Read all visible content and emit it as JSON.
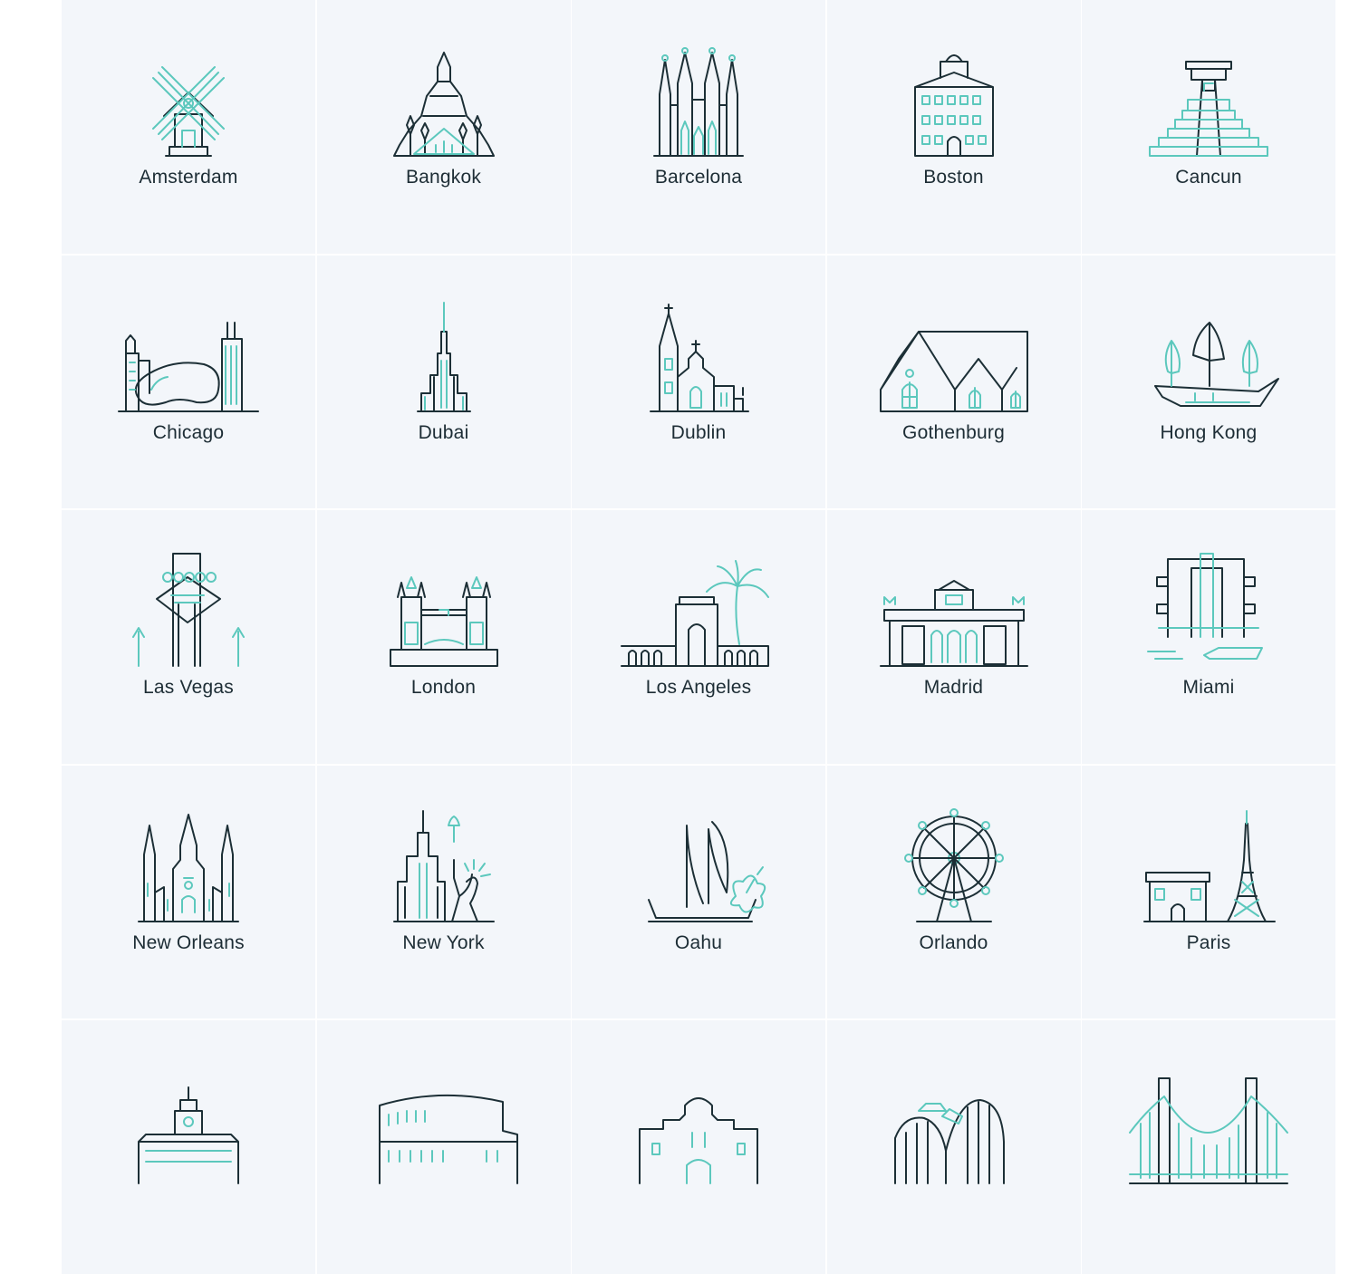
{
  "colors": {
    "tile_background": "#f3f6fa",
    "line_dark": "#1c2f36",
    "line_accent": "#5cc8bd",
    "label_text": "#1d2d35"
  },
  "cities": [
    {
      "label": "Amsterdam",
      "icon": "windmill-icon"
    },
    {
      "label": "Bangkok",
      "icon": "temple-icon"
    },
    {
      "label": "Barcelona",
      "icon": "cathedral-spires-icon"
    },
    {
      "label": "Boston",
      "icon": "state-house-icon"
    },
    {
      "label": "Cancun",
      "icon": "pyramid-icon"
    },
    {
      "label": "Chicago",
      "icon": "cloud-gate-icon"
    },
    {
      "label": "Dubai",
      "icon": "skyscraper-icon"
    },
    {
      "label": "Dublin",
      "icon": "church-icon"
    },
    {
      "label": "Gothenburg",
      "icon": "gabled-houses-icon"
    },
    {
      "label": "Hong Kong",
      "icon": "junk-boat-icon"
    },
    {
      "label": "Las Vegas",
      "icon": "vegas-sign-icon"
    },
    {
      "label": "London",
      "icon": "tower-bridge-icon"
    },
    {
      "label": "Los Angeles",
      "icon": "arch-palm-icon"
    },
    {
      "label": "Madrid",
      "icon": "museum-icon"
    },
    {
      "label": "Miami",
      "icon": "art-deco-hotel-icon"
    },
    {
      "label": "New Orleans",
      "icon": "st-louis-cathedral-icon"
    },
    {
      "label": "New York",
      "icon": "empire-liberty-icon"
    },
    {
      "label": "Oahu",
      "icon": "canoe-hibiscus-icon"
    },
    {
      "label": "Orlando",
      "icon": "ferris-wheel-icon"
    },
    {
      "label": "Paris",
      "icon": "eiffel-arc-icon"
    },
    {
      "label": "",
      "icon": "capitol-building-icon"
    },
    {
      "label": "",
      "icon": "colosseum-icon"
    },
    {
      "label": "",
      "icon": "mission-facade-icon"
    },
    {
      "label": "",
      "icon": "roller-coaster-icon"
    },
    {
      "label": "",
      "icon": "suspension-bridge-icon"
    }
  ]
}
